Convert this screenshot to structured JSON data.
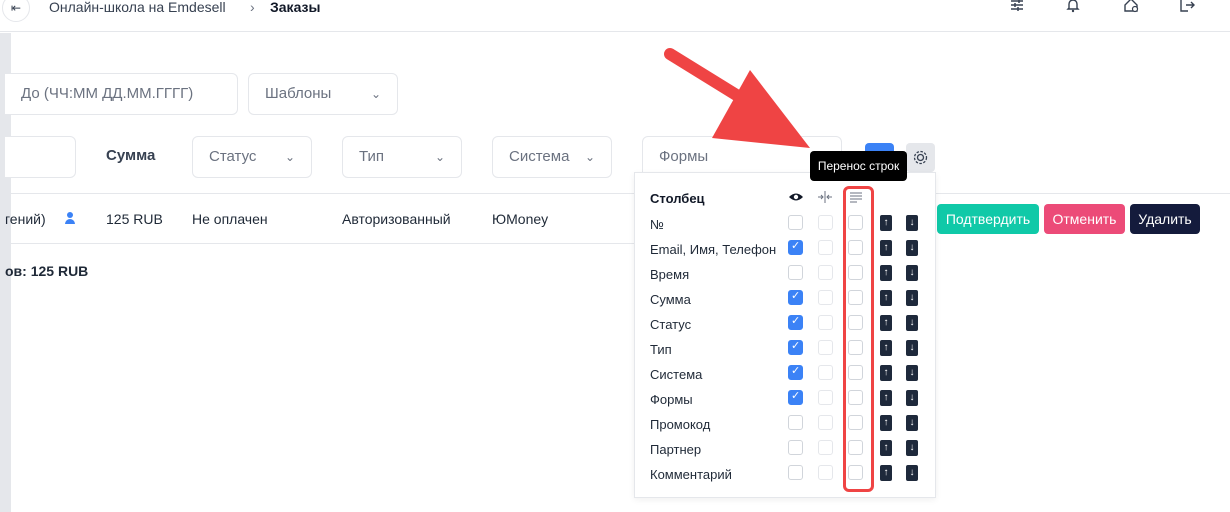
{
  "header": {
    "back_glyph": "⇤",
    "crumb_root": "Онлайн-школа на Emdesell",
    "crumb_sep": "›",
    "crumb_current": "Заказы",
    "icons": [
      "sliders-icon",
      "bell-icon",
      "home-settings-icon",
      "logout-icon"
    ]
  },
  "filters": {
    "date_to_placeholder": "До (ЧЧ:ММ ДД.ММ.ГГГГ)",
    "templates_label": "Шаблоны"
  },
  "columns_header": {
    "sum_label": "Сумма",
    "status_label": "Статус",
    "type_label": "Тип",
    "system_label": "Система",
    "forms_label": "Формы",
    "chevron": "⌄"
  },
  "order_row": {
    "user_text": "гений)",
    "amount": "125 RUB",
    "status": "Не оплачен",
    "type": "Авторизованный",
    "system": "ЮMoney",
    "confirm_label": "Подтвердить",
    "cancel_label": "Отменить",
    "delete_label": "Удалить"
  },
  "total_text": "ов: 125 RUB",
  "tooltip": "Перенос строк",
  "panel": {
    "title": "Столбец",
    "rows": [
      {
        "label": "№",
        "visible": false
      },
      {
        "label": "Email, Имя, Телефон",
        "visible": true
      },
      {
        "label": "Время",
        "visible": false
      },
      {
        "label": "Сумма",
        "visible": true
      },
      {
        "label": "Статус",
        "visible": true
      },
      {
        "label": "Тип",
        "visible": true
      },
      {
        "label": "Система",
        "visible": true
      },
      {
        "label": "Формы",
        "visible": true
      },
      {
        "label": "Промокод",
        "visible": false
      },
      {
        "label": "Партнер",
        "visible": false
      },
      {
        "label": "Комментарий",
        "visible": false
      }
    ]
  },
  "colors": {
    "confirm": "#10c9a8",
    "cancel": "#ec4b78",
    "delete": "#141b3c",
    "accent": "#3b82f6",
    "annotation": "#ef4444"
  }
}
